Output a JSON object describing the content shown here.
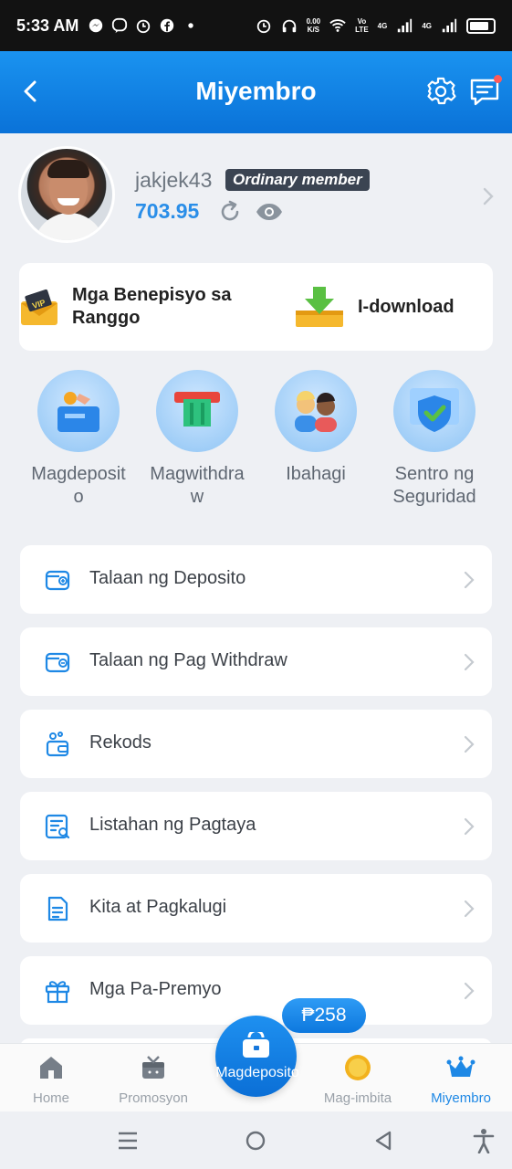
{
  "status_bar": {
    "time": "5:33 AM",
    "net_speed_value": "0.00",
    "net_speed_unit": "K/S",
    "volte_top": "Vo",
    "volte_bottom": "LTE",
    "sim1": "4G",
    "sim2": "4G"
  },
  "header": {
    "title": "Miyembro"
  },
  "profile": {
    "username": "jakjek43",
    "member_badge": "Ordinary member",
    "balance": "703.95"
  },
  "shortcuts": {
    "rank_benefits": "Mga Benepisyo sa Ranggo",
    "download": "I-download"
  },
  "quick_actions": [
    {
      "label": "Magdeposito"
    },
    {
      "label": "Magwithdraw"
    },
    {
      "label": "Ibahagi"
    },
    {
      "label": "Sentro ng Seguridad"
    }
  ],
  "menu": [
    {
      "label": "Talaan ng Deposito"
    },
    {
      "label": "Talaan ng Pag Withdraw"
    },
    {
      "label": "Rekods"
    },
    {
      "label": "Listahan ng Pagtaya"
    },
    {
      "label": "Kita at Pagkalugi"
    },
    {
      "label": "Mga Pa-Premyo"
    }
  ],
  "bonus_badge": "₱258",
  "tabs": [
    {
      "label": "Home"
    },
    {
      "label": "Promosyon"
    },
    {
      "label": "Magdeposito"
    },
    {
      "label": "Mag-imbita"
    },
    {
      "label": "Miyembro"
    }
  ],
  "colors": {
    "primary": "#1a8cf0",
    "active_tab": "#1e88e5",
    "badge_bg": "#3b4452",
    "balance": "#2a8ee8"
  }
}
